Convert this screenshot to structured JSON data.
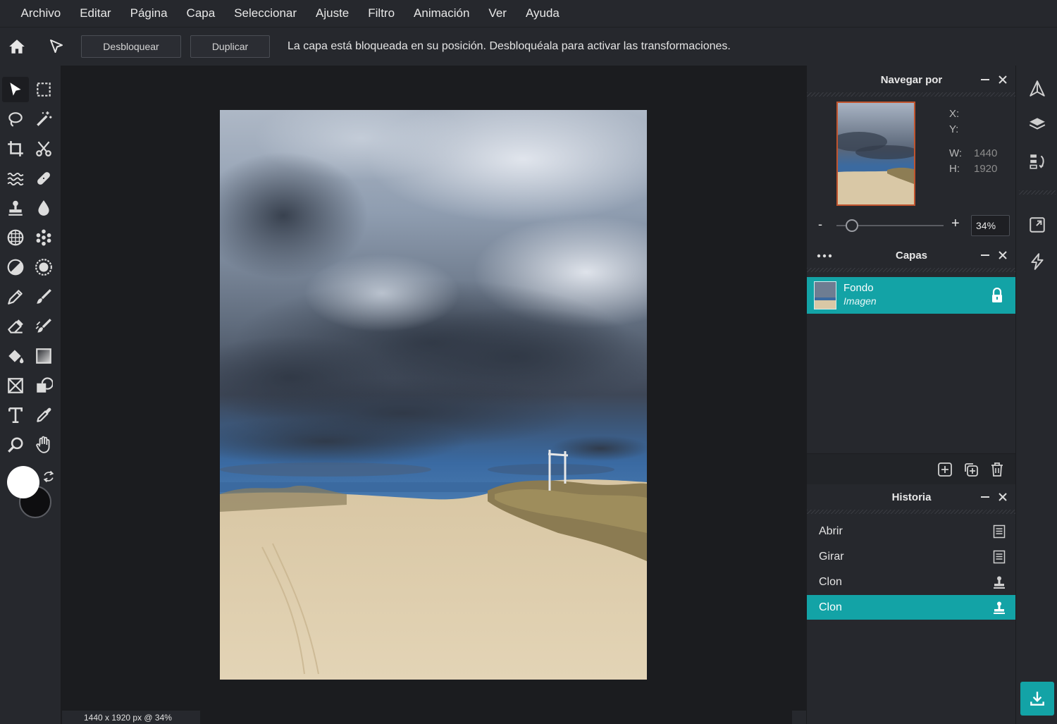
{
  "menu": [
    "Archivo",
    "Editar",
    "Página",
    "Capa",
    "Seleccionar",
    "Ajuste",
    "Filtro",
    "Animación",
    "Ver",
    "Ayuda"
  ],
  "toolbar": {
    "unlock_label": "Desbloquear",
    "duplicate_label": "Duplicar",
    "message": "La capa está bloqueada en su posición. Desbloquéala para activar las transformaciones."
  },
  "colors": {
    "accent": "#13a3a6",
    "foreground_swatch": "#ffffff",
    "background_swatch": "#0e0e10",
    "nav_thumb_border": "#c0542e"
  },
  "status": {
    "text": "1440 x 1920 px @ 34%"
  },
  "navigator": {
    "title": "Navegar por",
    "x_label": "X:",
    "x_value": "",
    "y_label": "Y:",
    "y_value": "",
    "w_label": "W:",
    "w_value": "1440",
    "h_label": "H:",
    "h_value": "1920",
    "zoom_minus": "-",
    "zoom_plus": "+",
    "zoom_value": "34%",
    "zoom_slider_fraction": 0.1
  },
  "layers": {
    "title": "Capas",
    "items": [
      {
        "name": "Fondo",
        "type": "Imagen",
        "locked": true,
        "selected": true
      }
    ]
  },
  "history": {
    "title": "Historia",
    "items": [
      {
        "label": "Abrir",
        "icon": "document-icon"
      },
      {
        "label": "Girar",
        "icon": "document-icon"
      },
      {
        "label": "Clon",
        "icon": "stamp-icon"
      },
      {
        "label": "Clon",
        "icon": "stamp-icon",
        "active": true
      }
    ]
  }
}
